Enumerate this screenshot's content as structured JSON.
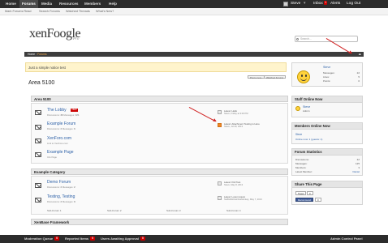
{
  "navbar": {
    "tabs": [
      "Home",
      "Forums",
      "Media",
      "Resources",
      "Members",
      "Help"
    ],
    "user_name": "Steve",
    "inbox_label": "Inbox",
    "inbox_count": "1",
    "alerts_label": "Alerts",
    "logout_label": "Log Out"
  },
  "subnav": {
    "links": [
      "Mark Forums Read",
      "Search Forums",
      "Watched Threads",
      "What's New?"
    ]
  },
  "logo": {
    "title": "xenFoogle",
    "sub": "Pro"
  },
  "search": {
    "placeholder": "Search..."
  },
  "breadcrumb": {
    "home": "Home",
    "forums": "Forums",
    "end_marker": "◂▸"
  },
  "notice": {
    "text": "Just a simple notice test"
  },
  "buttons": {
    "post_new": "Post a new...",
    "watch": "Watched Forums"
  },
  "page_title": "Area 5100",
  "categories": [
    {
      "title": "Area 5100",
      "nodes": [
        {
          "title": "The Lobby",
          "badge": "NEW",
          "meta_discussions": "Discussions:",
          "discussions": "36",
          "meta_messages": "Messages:",
          "messages": "121",
          "latest_title": "Latest: Hello",
          "latest_meta": "Steve, Friday at 3:00 PM",
          "rss": false
        },
        {
          "title": "Example Forum",
          "badge": "",
          "meta_discussions": "Discussions:",
          "discussions": "2",
          "meta_messages": "Messages:",
          "messages": "6",
          "latest_title": "Latest: Attachment Testing is Here",
          "latest_meta": "Steve, Jul 29, 2013",
          "rss": true
        },
        {
          "title": "XenForo.com",
          "badge": "",
          "meta_line": "Link to XenForo.com"
        },
        {
          "title": "Example Page",
          "badge": "",
          "meta_line": "Info Page"
        }
      ]
    },
    {
      "title": "Example Category",
      "nodes": [
        {
          "title": "Demo Forum",
          "badge": "",
          "meta_discussions": "Discussions:",
          "discussions": "2",
          "meta_messages": "Messages:",
          "messages": "2",
          "latest_title": "Latest: Poll Test",
          "latest_meta": "Steve, May 8, 2013",
          "rss": false
        },
        {
          "title": "Testing, Testing",
          "badge": "",
          "meta_discussions": "Discussions:",
          "discussions": "2",
          "meta_messages": "Messages:",
          "messages": "8",
          "latest_title": "Latest: Lorem ipsum",
          "latest_meta": "SteBotMcFalcheeMonkey, May 7, 2013",
          "rss": false
        }
      ],
      "subforums": [
        "Sub-Forum 1",
        "Sub-Forum 2",
        "Sub-Forum 3",
        "Sub-Forum 4"
      ]
    },
    {
      "title": "XenBase Framework"
    }
  ],
  "sidebar": {
    "profile": {
      "name": "Steve",
      "rows": [
        {
          "label": "Messages:",
          "value": "22"
        },
        {
          "label": "Likes:",
          "value": "5"
        },
        {
          "label": "Points:",
          "value": "0"
        }
      ]
    },
    "staff": {
      "title": "Staff Online Now",
      "name": "Steve",
      "role": "Admin"
    },
    "members": {
      "title": "Members Online Now",
      "name": "Steve",
      "summary": "Online now: 1 (guests: 1)"
    },
    "stats": {
      "title": "Forum Statistics",
      "rows": [
        {
          "label": "Discussions:",
          "value": "42"
        },
        {
          "label": "Messages:",
          "value": "125"
        },
        {
          "label": "Members:",
          "value": "3"
        },
        {
          "label": "Latest Member:",
          "value": "Daniel"
        }
      ]
    },
    "share": {
      "title": "Share This Page",
      "tweet": "Tweet",
      "tweet_count": "0",
      "recommend": "Recommend",
      "recommend_count": "0"
    }
  },
  "bottombar": {
    "moderation_label": "Moderation Queue",
    "moderation_count": "0",
    "reported_label": "Reported Items",
    "reported_count": "0",
    "approval_label": "Users Awaiting Approval",
    "approval_count": "0",
    "admin_label": "Admin Control Panel"
  }
}
